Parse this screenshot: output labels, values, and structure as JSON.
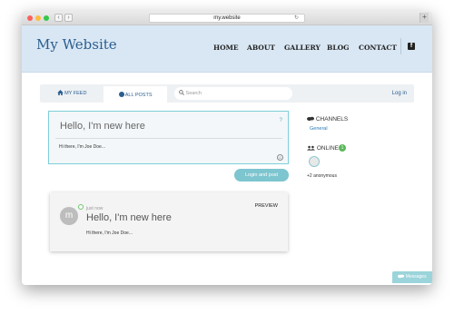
{
  "browser": {
    "url": "my.website",
    "reload_glyph": "↻",
    "back_glyph": "‹",
    "forward_glyph": "›",
    "newtab_glyph": "+"
  },
  "header": {
    "brand": "My Website",
    "nav": [
      "HOME",
      "ABOUT",
      "GALLERY",
      "BLOG",
      "CONTACT"
    ],
    "social_icon": "facebook-icon",
    "social_glyph": "f"
  },
  "tabs": {
    "my_feed": "MY FEED",
    "all_posts": "ALL POSTS",
    "search_placeholder": "Search",
    "login": "Log in"
  },
  "composer": {
    "title": "Hello, I'm new here",
    "help": "?",
    "body": "Hi there, I'm Joe Doe...",
    "emoji_glyph": "☺",
    "submit": "Login and post"
  },
  "preview": {
    "avatar_letter": "m",
    "time": "just now",
    "title": "Hello, I'm new here",
    "label": "PREVIEW",
    "body": "Hi there, I'm Joe Doe..."
  },
  "sidebar": {
    "channels_label": "CHANNELS",
    "channel": "General",
    "online_label": "ONLINE",
    "online_count": "1",
    "anonymous": "+2 anonymous"
  },
  "messages_label": "Messages",
  "colors": {
    "accent": "#2a5e90",
    "header_bg": "#d9e7f4",
    "teal": "#7dc5cf",
    "online": "#5cb85c"
  }
}
